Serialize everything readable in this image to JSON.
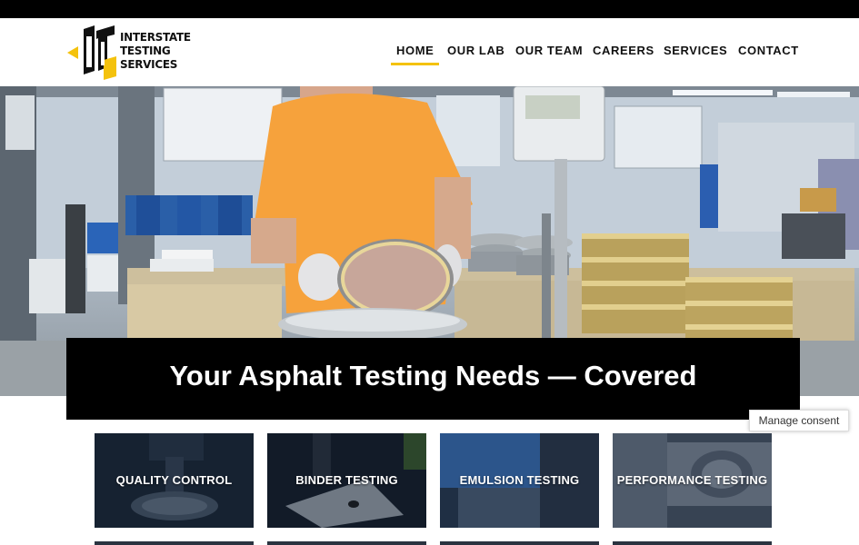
{
  "brand": {
    "name_lines": [
      "INTERSTATE",
      "TESTING",
      "SERVICES"
    ],
    "accent_color": "#f4c20d",
    "logo_icon": "its-monogram-logo"
  },
  "nav": {
    "items": [
      {
        "label": "HOME",
        "active": true
      },
      {
        "label": "OUR LAB",
        "active": false
      },
      {
        "label": "OUR TEAM",
        "active": false
      },
      {
        "label": "CAREERS",
        "active": false
      },
      {
        "label": "SERVICES",
        "active": false
      },
      {
        "label": "CONTACT",
        "active": false
      }
    ]
  },
  "hero": {
    "headline": "Your Asphalt Testing Needs — Covered",
    "image": "lab-technician-sieve-photo"
  },
  "consent": {
    "label": "Manage consent"
  },
  "services": {
    "tiles": [
      {
        "label": "QUALITY CONTROL"
      },
      {
        "label": "BINDER TESTING"
      },
      {
        "label": "EMULSION TESTING"
      },
      {
        "label": "PERFORMANCE TESTING"
      }
    ]
  }
}
